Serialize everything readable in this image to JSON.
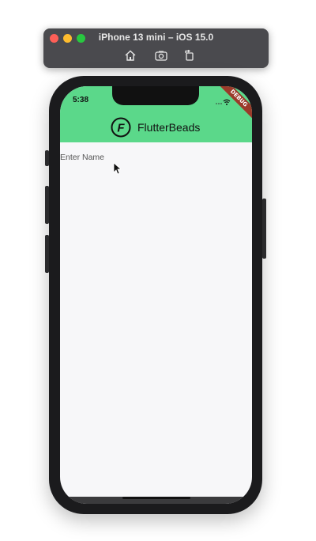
{
  "simulator": {
    "title": "iPhone 13 mini – iOS 15.0",
    "toolbar_icons": [
      "home-icon",
      "screenshot-icon",
      "rotate-icon"
    ]
  },
  "status_bar": {
    "time": "5:38",
    "debug_banner": "DEBUG"
  },
  "app_bar": {
    "logo_letter": "F",
    "title": "FlutterBeads",
    "color": "#5bd88a"
  },
  "form": {
    "name_placeholder": "Enter Name",
    "name_value": ""
  }
}
